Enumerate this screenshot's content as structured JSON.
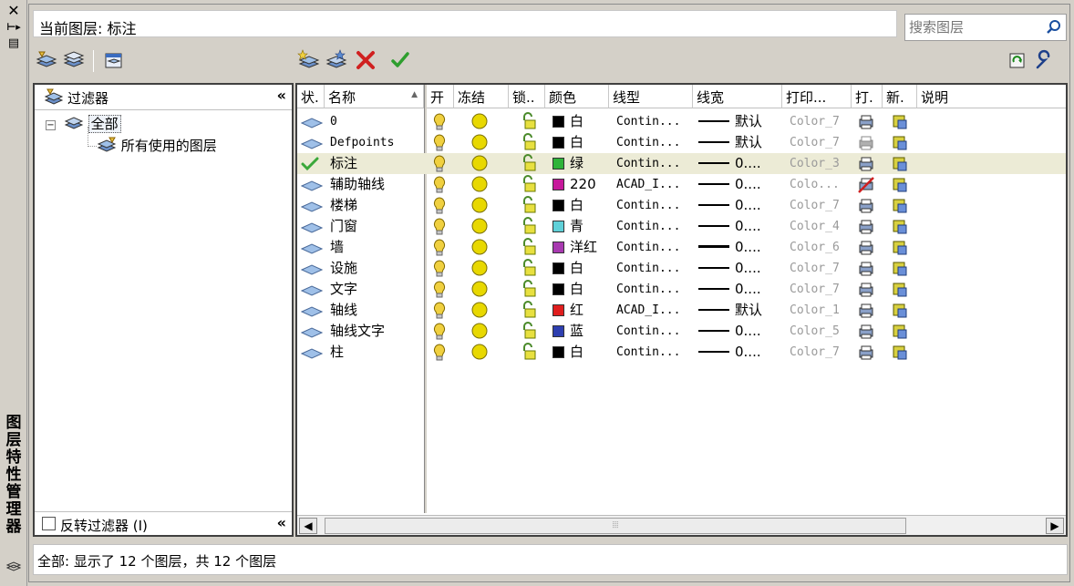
{
  "palette_title": "图层特性管理器",
  "current_layer": {
    "label": "当前图层:",
    "value": "标注"
  },
  "search": {
    "placeholder": "搜索图层"
  },
  "filter_tree": {
    "header": "过滤器",
    "collapse_symbol": "«",
    "nodes": [
      {
        "label": "全部"
      },
      {
        "label": "所有使用的图层"
      }
    ],
    "invert_filter_label": "反转过滤器 (I)"
  },
  "columns": {
    "status": "状.",
    "name": "名称",
    "on": "开",
    "freeze": "冻结",
    "lock": "锁..",
    "color": "颜色",
    "linetype": "线型",
    "lineweight": "线宽",
    "plot_style": "打印...",
    "plot": "打.",
    "new_vp_freeze": "新.",
    "description": "说明"
  },
  "layers": [
    {
      "name": "0",
      "status": "layer",
      "color_name": "白",
      "color_hex": "#000000",
      "linetype": "Contin...",
      "lineweight": "默认",
      "plot_style": "Color_7",
      "plot_enabled": true,
      "selected": false,
      "plot_greyed": false
    },
    {
      "name": "Defpoints",
      "status": "layer",
      "color_name": "白",
      "color_hex": "#000000",
      "linetype": "Contin...",
      "lineweight": "默认",
      "plot_style": "Color_7",
      "plot_enabled": true,
      "selected": false,
      "plot_greyed": true
    },
    {
      "name": "标注",
      "status": "current",
      "color_name": "绿",
      "color_hex": "#2fb33a",
      "linetype": "Contin...",
      "lineweight": "0....",
      "plot_style": "Color_3",
      "plot_enabled": true,
      "selected": true,
      "plot_greyed": false
    },
    {
      "name": "辅助轴线",
      "status": "layer",
      "color_name": "220",
      "color_hex": "#c6199b",
      "linetype": "ACAD_I...",
      "lineweight": "0....",
      "plot_style": "Colo...",
      "plot_enabled": false,
      "selected": false,
      "plot_greyed": false
    },
    {
      "name": "楼梯",
      "status": "layer",
      "color_name": "白",
      "color_hex": "#000000",
      "linetype": "Contin...",
      "lineweight": "0....",
      "plot_style": "Color_7",
      "plot_enabled": true,
      "selected": false,
      "plot_greyed": false
    },
    {
      "name": "门窗",
      "status": "layer",
      "color_name": "青",
      "color_hex": "#5fd0d8",
      "linetype": "Contin...",
      "lineweight": "0....",
      "plot_style": "Color_4",
      "plot_enabled": true,
      "selected": false,
      "plot_greyed": false
    },
    {
      "name": "墙",
      "status": "layer",
      "color_name": "洋红",
      "color_hex": "#a83ab0",
      "linetype": "Contin...",
      "lineweight": "0....",
      "plot_style": "Color_6",
      "plot_enabled": true,
      "selected": false,
      "plot_greyed": false,
      "thick_line": true
    },
    {
      "name": "设施",
      "status": "layer",
      "color_name": "白",
      "color_hex": "#000000",
      "linetype": "Contin...",
      "lineweight": "0....",
      "plot_style": "Color_7",
      "plot_enabled": true,
      "selected": false,
      "plot_greyed": false
    },
    {
      "name": "文字",
      "status": "layer",
      "color_name": "白",
      "color_hex": "#000000",
      "linetype": "Contin...",
      "lineweight": "0....",
      "plot_style": "Color_7",
      "plot_enabled": true,
      "selected": false,
      "plot_greyed": false
    },
    {
      "name": "轴线",
      "status": "layer",
      "color_name": "红",
      "color_hex": "#e01e1e",
      "linetype": "ACAD_I...",
      "lineweight": "默认",
      "plot_style": "Color_1",
      "plot_enabled": true,
      "selected": false,
      "plot_greyed": false
    },
    {
      "name": "轴线文字",
      "status": "layer",
      "color_name": "蓝",
      "color_hex": "#2e3fb0",
      "linetype": "Contin...",
      "lineweight": "0....",
      "plot_style": "Color_5",
      "plot_enabled": true,
      "selected": false,
      "plot_greyed": false
    },
    {
      "name": "柱",
      "status": "layer",
      "color_name": "白",
      "color_hex": "#000000",
      "linetype": "Contin...",
      "lineweight": "0....",
      "plot_style": "Color_7",
      "plot_enabled": true,
      "selected": false,
      "plot_greyed": false
    }
  ],
  "status_text": "全部: 显示了 12 个图层，共 12 个图层",
  "colors": {
    "selected_row": "#ecebd6",
    "bulb": "#f0d040",
    "sun": "#e8d800",
    "current_check": "#3aa83a"
  }
}
